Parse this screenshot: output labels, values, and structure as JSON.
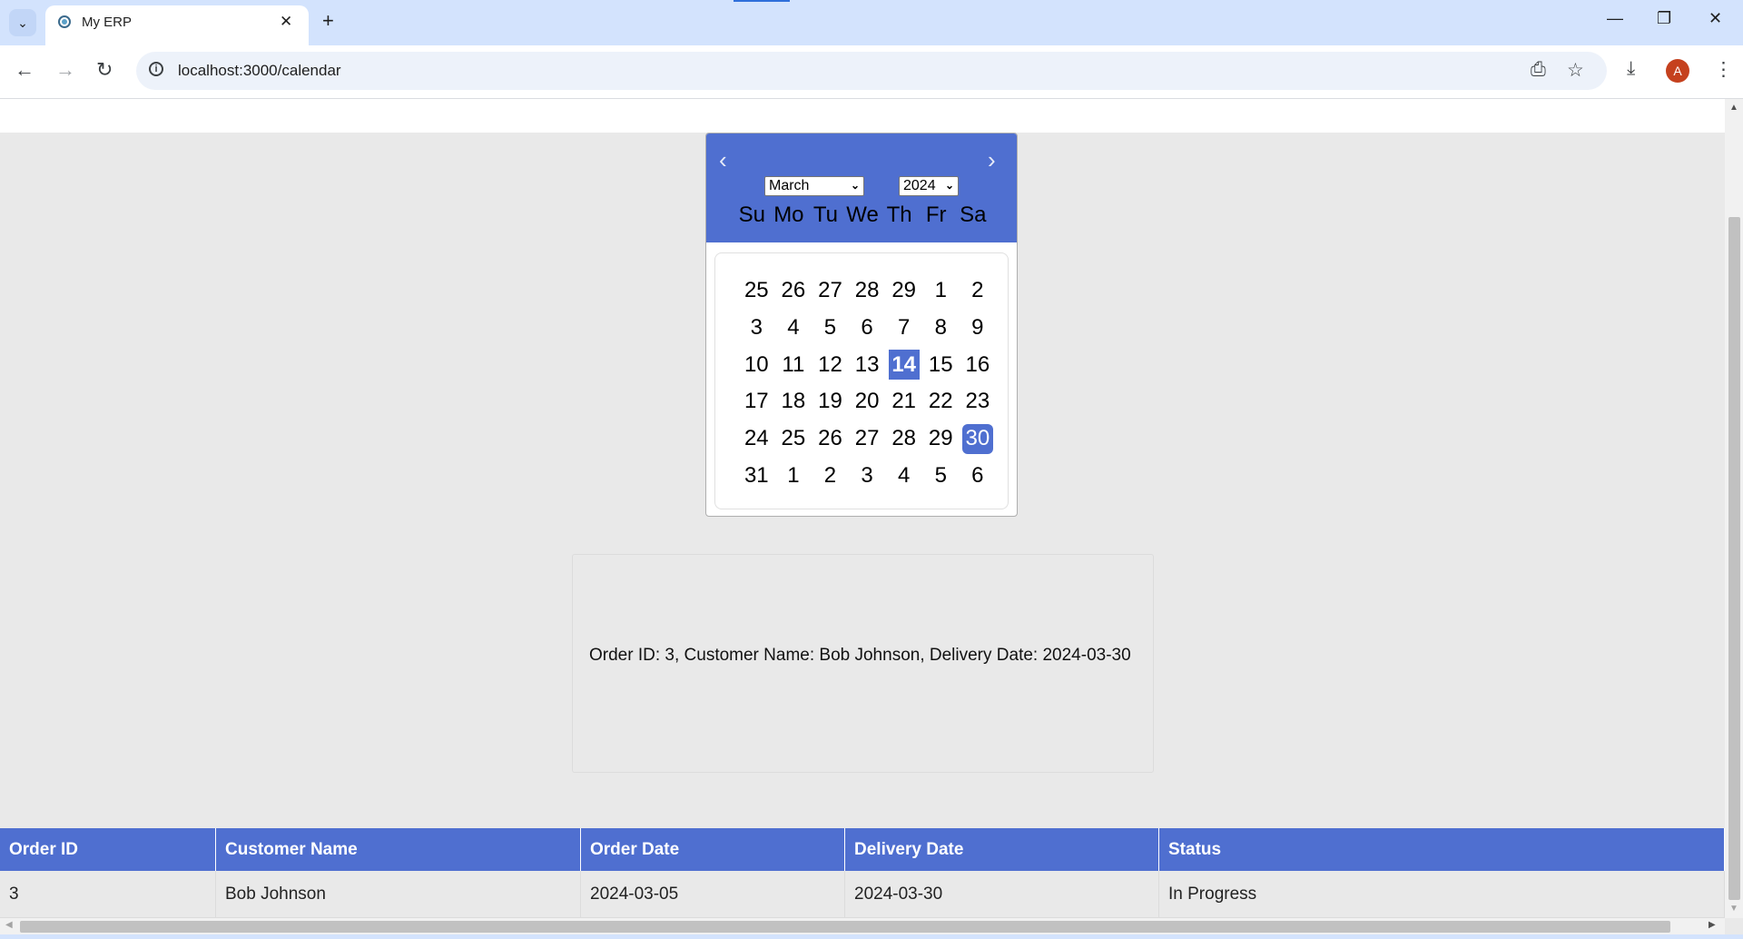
{
  "browser": {
    "tab_title": "My ERP",
    "close_glyph": "✕",
    "new_tab_glyph": "+",
    "url": "localhost:3000/calendar",
    "profile_initial": "A"
  },
  "calendar": {
    "prev_glyph": "‹",
    "next_glyph": "›",
    "month": "March",
    "year": "2024",
    "weekdays": [
      "Su",
      "Mo",
      "Tu",
      "We",
      "Th",
      "Fr",
      "Sa"
    ],
    "weeks": [
      [
        "25",
        "26",
        "27",
        "28",
        "29",
        "1",
        "2"
      ],
      [
        "3",
        "4",
        "5",
        "6",
        "7",
        "8",
        "9"
      ],
      [
        "10",
        "11",
        "12",
        "13",
        "14",
        "15",
        "16"
      ],
      [
        "17",
        "18",
        "19",
        "20",
        "21",
        "22",
        "23"
      ],
      [
        "24",
        "25",
        "26",
        "27",
        "28",
        "29",
        "30"
      ],
      [
        "31",
        "1",
        "2",
        "3",
        "4",
        "5",
        "6"
      ]
    ],
    "today": "14",
    "selected": "30",
    "accent_color": "#4f6fd0"
  },
  "details": {
    "text": "Order ID: 3, Customer Name: Bob Johnson, Delivery Date: 2024-03-30"
  },
  "orders_table": {
    "headers": [
      "Order ID",
      "Customer Name",
      "Order Date",
      "Delivery Date",
      "Status"
    ],
    "rows": [
      [
        "3",
        "Bob Johnson",
        "2024-03-05",
        "2024-03-30",
        "In Progress"
      ]
    ]
  }
}
